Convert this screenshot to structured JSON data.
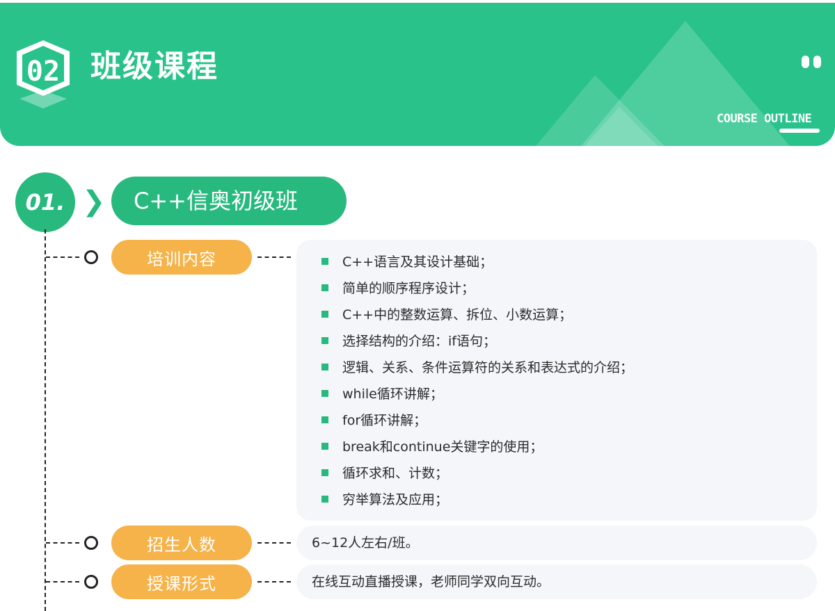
{
  "header": {
    "badge_number": "02",
    "title": "班级课程",
    "subtitle": "COURSE OUTLINE",
    "colors": {
      "primary": "#28c28a",
      "accent": "#f5b349"
    }
  },
  "section": {
    "number": "01.",
    "title": "C++信奥初级班",
    "rows": [
      {
        "label": "培训内容",
        "items": [
          "C++语言及其设计基础；",
          "简单的顺序程序设计；",
          "C++中的整数运算、拆位、小数运算；",
          "选择结构的介绍：if语句；",
          "逻辑、关系、条件运算符的关系和表达式的介绍；",
          "while循环讲解；",
          "for循环讲解；",
          "break和continue关键字的使用；",
          "循环求和、计数；",
          "穷举算法及应用；"
        ]
      },
      {
        "label": "招生人数",
        "text": "6~12人左右/班。"
      },
      {
        "label": "授课形式",
        "text": "在线互动直播授课，老师同学双向互动。"
      }
    ]
  }
}
